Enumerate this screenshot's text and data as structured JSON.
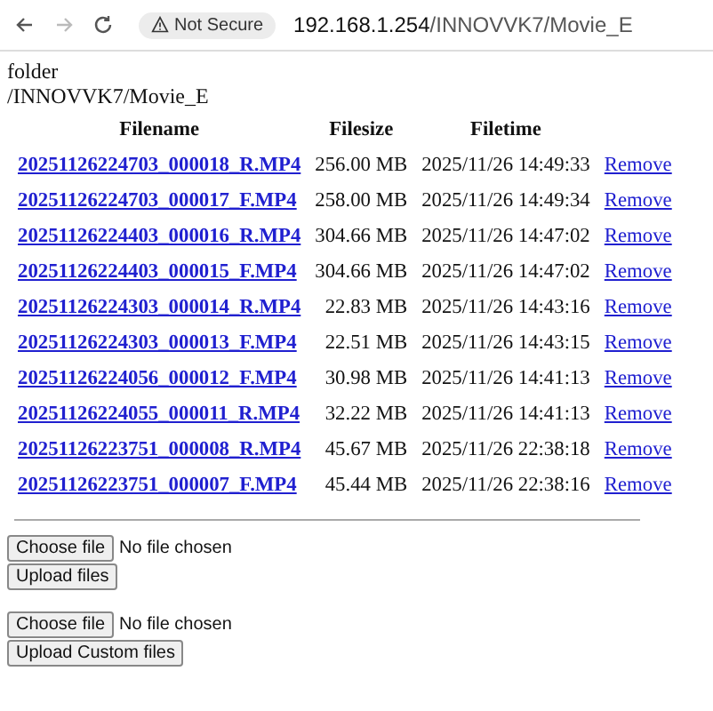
{
  "browser": {
    "security_label": "Not Secure",
    "url_host": "192.168.1.254",
    "url_path": "/INNOVVK7/Movie_E"
  },
  "heading": {
    "label": "folder",
    "path": "/INNOVVK7/Movie_E"
  },
  "table": {
    "columns": [
      "Filename",
      "Filesize",
      "Filetime"
    ],
    "rows": [
      {
        "filename": "20251126224703_000018_R.MP4",
        "filesize": "256.00 MB",
        "filetime": "2025/11/26 14:49:33",
        "action": "Remove"
      },
      {
        "filename": "20251126224703_000017_F.MP4",
        "filesize": "258.00 MB",
        "filetime": "2025/11/26 14:49:34",
        "action": "Remove"
      },
      {
        "filename": "20251126224403_000016_R.MP4",
        "filesize": "304.66 MB",
        "filetime": "2025/11/26 14:47:02",
        "action": "Remove"
      },
      {
        "filename": "20251126224403_000015_F.MP4",
        "filesize": "304.66 MB",
        "filetime": "2025/11/26 14:47:02",
        "action": "Remove"
      },
      {
        "filename": "20251126224303_000014_R.MP4",
        "filesize": "22.83 MB",
        "filetime": "2025/11/26 14:43:16",
        "action": "Remove"
      },
      {
        "filename": "20251126224303_000013_F.MP4",
        "filesize": "22.51 MB",
        "filetime": "2025/11/26 14:43:15",
        "action": "Remove"
      },
      {
        "filename": "20251126224056_000012_F.MP4",
        "filesize": "30.98 MB",
        "filetime": "2025/11/26 14:41:13",
        "action": "Remove"
      },
      {
        "filename": "20251126224055_000011_R.MP4",
        "filesize": "32.22 MB",
        "filetime": "2025/11/26 14:41:13",
        "action": "Remove"
      },
      {
        "filename": "20251126223751_000008_R.MP4",
        "filesize": "45.67 MB",
        "filetime": "2025/11/26 22:38:18",
        "action": "Remove"
      },
      {
        "filename": "20251126223751_000007_F.MP4",
        "filesize": "45.44 MB",
        "filetime": "2025/11/26 22:38:16",
        "action": "Remove"
      }
    ]
  },
  "upload_forms": [
    {
      "choose_button": "Choose file",
      "file_status": "No file chosen",
      "submit": "Upload files"
    },
    {
      "choose_button": "Choose file",
      "file_status": "No file chosen",
      "submit": "Upload Custom files"
    }
  ]
}
